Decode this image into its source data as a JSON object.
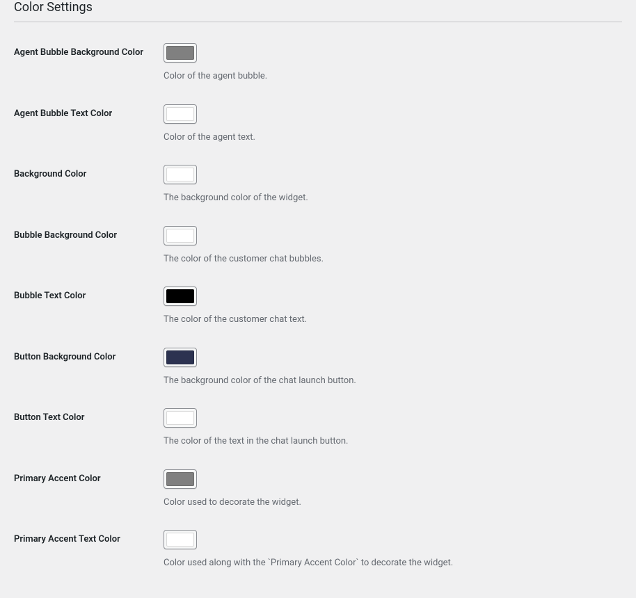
{
  "section": {
    "title": "Color Settings"
  },
  "fields": [
    {
      "label": "Agent Bubble Background Color",
      "color": "#808080",
      "description": "Color of the agent bubble.",
      "name": "agent-bubble-background-color"
    },
    {
      "label": "Agent Bubble Text Color",
      "color": "#ffffff",
      "description": "Color of the agent text.",
      "name": "agent-bubble-text-color"
    },
    {
      "label": "Background Color",
      "color": "#ffffff",
      "description": "The background color of the widget.",
      "name": "background-color"
    },
    {
      "label": "Bubble Background Color",
      "color": "#ffffff",
      "description": "The color of the customer chat bubbles.",
      "name": "bubble-background-color"
    },
    {
      "label": "Bubble Text Color",
      "color": "#000000",
      "description": "The color of the customer chat text.",
      "name": "bubble-text-color"
    },
    {
      "label": "Button Background Color",
      "color": "#2c3250",
      "description": "The background color of the chat launch button.",
      "name": "button-background-color"
    },
    {
      "label": "Button Text Color",
      "color": "#ffffff",
      "description": "The color of the text in the chat launch button.",
      "name": "button-text-color"
    },
    {
      "label": "Primary Accent Color",
      "color": "#808080",
      "description": "Color used to decorate the widget.",
      "name": "primary-accent-color"
    },
    {
      "label": "Primary Accent Text Color",
      "color": "#ffffff",
      "description": "Color used along with the `Primary Accent Color` to decorate the widget.",
      "name": "primary-accent-text-color"
    }
  ]
}
